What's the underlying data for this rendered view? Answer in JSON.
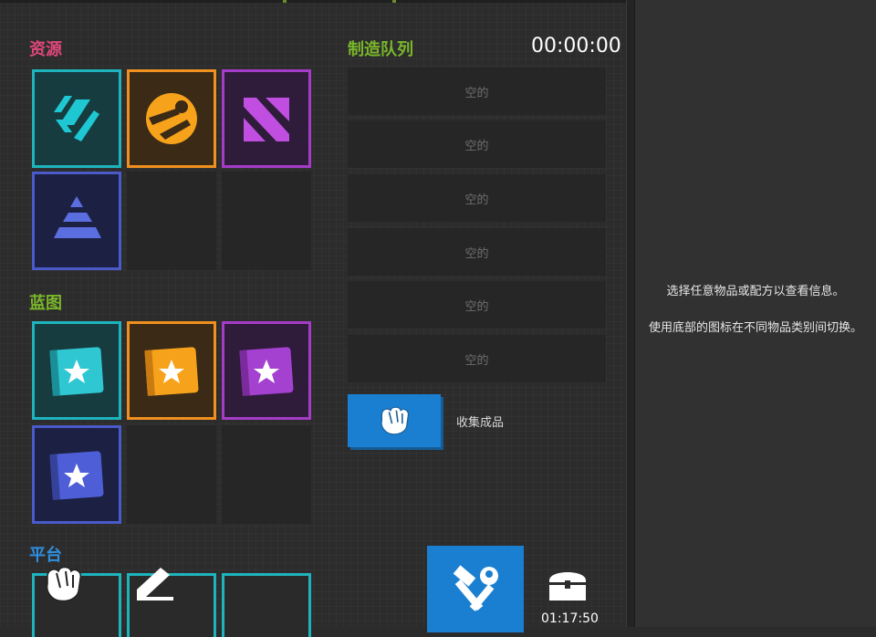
{
  "resources": {
    "title": "资源",
    "items": [
      {
        "name": "resource-teal-icon",
        "color": "#1eb4be"
      },
      {
        "name": "resource-orange-icon",
        "color": "#f0901e"
      },
      {
        "name": "resource-purple-icon",
        "color": "#a53cc8"
      },
      {
        "name": "resource-blue-icon",
        "color": "#4a5ac8"
      }
    ]
  },
  "blueprints": {
    "title": "蓝图",
    "items": [
      {
        "name": "blueprint-teal-icon",
        "color": "#1eb4be"
      },
      {
        "name": "blueprint-orange-icon",
        "color": "#f0901e"
      },
      {
        "name": "blueprint-purple-icon",
        "color": "#a53cc8"
      },
      {
        "name": "blueprint-blue-icon",
        "color": "#4a5ac8"
      }
    ]
  },
  "platforms": {
    "title": "平台"
  },
  "queue": {
    "title": "制造队列",
    "timer": "00:00:00",
    "slots": [
      "空的",
      "空的",
      "空的",
      "空的",
      "空的",
      "空的"
    ],
    "collect_label": "收集成品"
  },
  "chest": {
    "time": "01:17:50"
  },
  "info": {
    "line1": "选择任意物品或配方以查看信息。",
    "line2": "使用底部的图标在不同物品类别间切换。"
  },
  "colors": {
    "resources_title": "#e0477a",
    "blueprints_title": "#7ab62a",
    "queue_title": "#7ab62a",
    "platforms_title": "#2f8fe0",
    "accent_blue": "#1a7fd0"
  }
}
